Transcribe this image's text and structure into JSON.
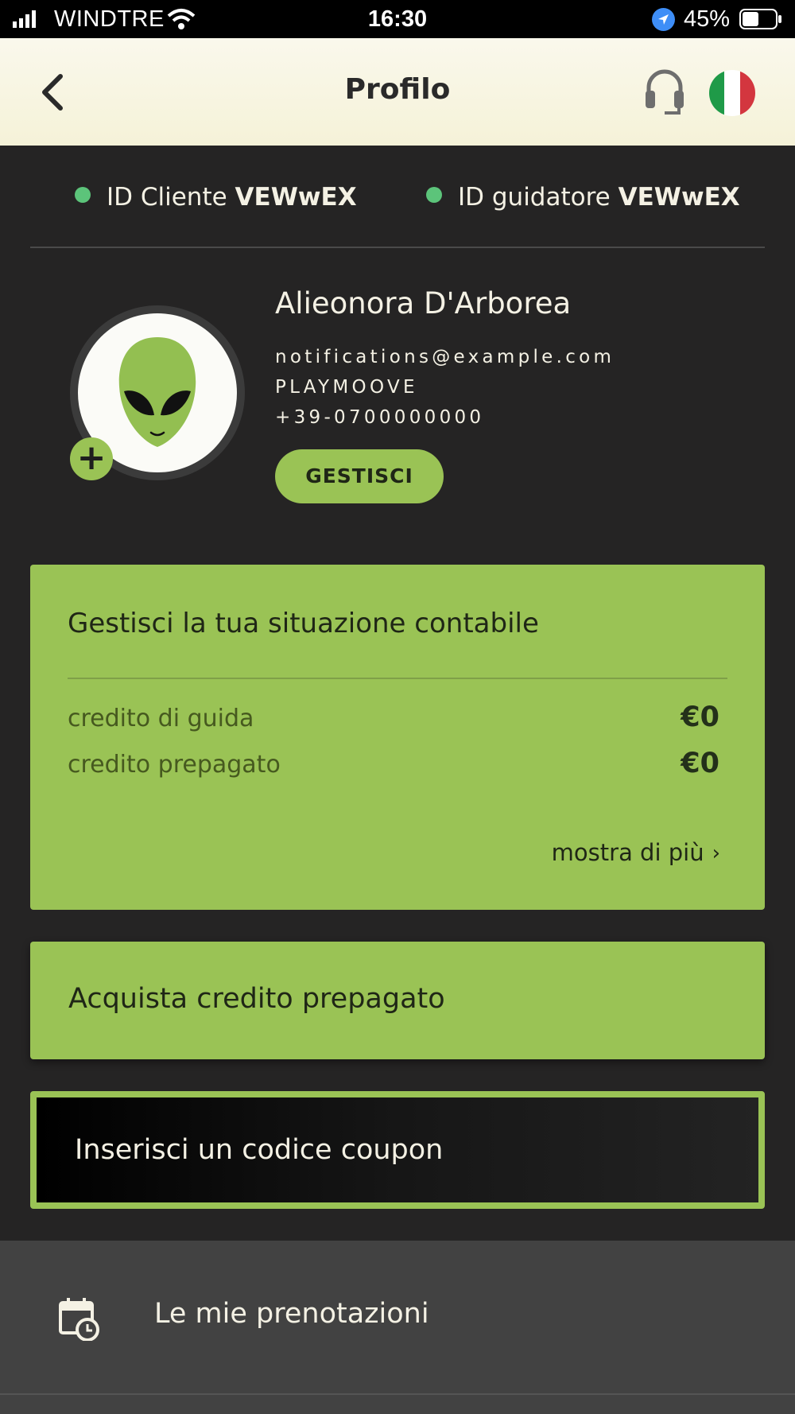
{
  "status_bar": {
    "carrier": "WINDTRE",
    "time": "16:30",
    "battery": "45%"
  },
  "header": {
    "title": "Profilo",
    "back_icon": "chevron-left-icon",
    "support_icon": "headset-icon",
    "language_icon": "italy-flag-icon",
    "flag_colors": [
      "#1f9a48",
      "#ffffff",
      "#d3363f"
    ]
  },
  "ids": {
    "customer_label": "ID Cliente",
    "customer_value": "VEWwEX",
    "driver_label": "ID guidatore",
    "driver_value": "VEWwEX",
    "dot_color": "#5cc47a"
  },
  "profile": {
    "name": "Alieonora D'Arborea",
    "email": "notifications@example.com",
    "company": "PLAYMOOVE",
    "phone": "+39-0700000000",
    "manage_label": "GESTISCI",
    "avatar_icon": "alien-icon",
    "add_photo_label": "+"
  },
  "account": {
    "title": "Gestisci la tua situazione contabile",
    "rows": [
      {
        "label": "credito di guida",
        "value": "€0"
      },
      {
        "label": "credito prepagato",
        "value": "€0"
      }
    ],
    "show_more_label": "mostra di più",
    "show_more_chevron": "›"
  },
  "buy_credit": {
    "label": "Acquista credito prepagato"
  },
  "coupon": {
    "label": "Inserisci un codice coupon"
  },
  "bookings": {
    "label": "Le mie prenotazioni",
    "icon": "calendar-clock-icon"
  },
  "colors": {
    "accent": "#9ac355",
    "background": "#252424",
    "text": "#f4f1e4"
  }
}
